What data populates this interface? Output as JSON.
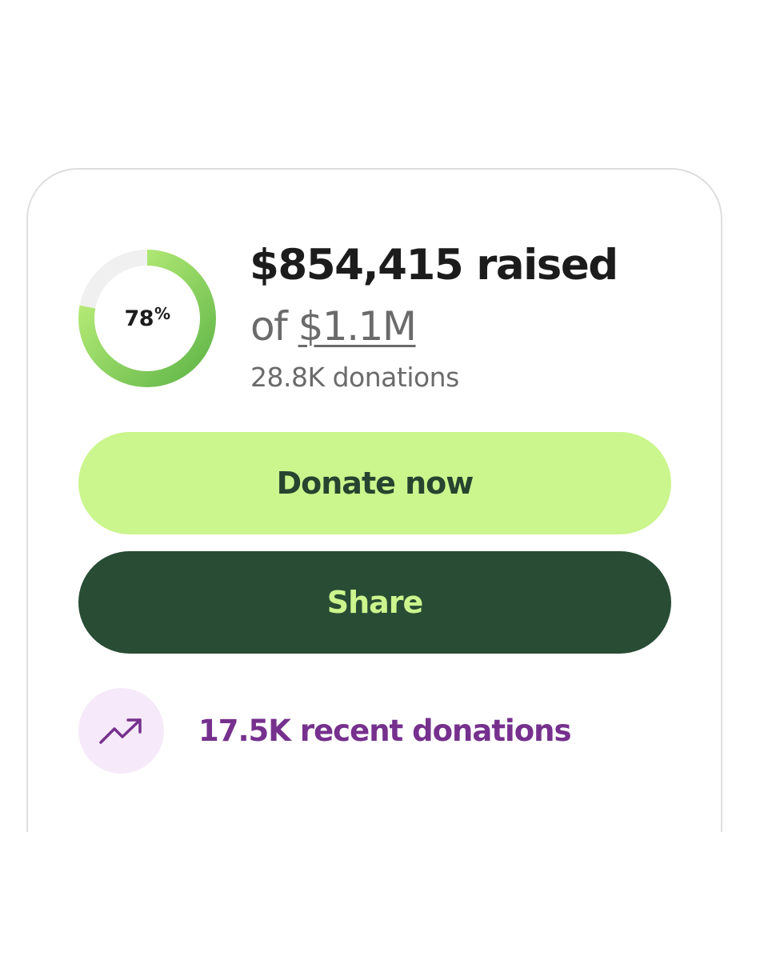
{
  "progress": {
    "percent_label": "78",
    "percent_symbol": "%",
    "fraction": 0.78
  },
  "summary": {
    "raised_text": "$854,415 raised",
    "goal_prefix": "of ",
    "goal_amount": "$1.1M",
    "donation_count": "28.8K donations"
  },
  "actions": {
    "donate_label": "Donate now",
    "share_label": "Share"
  },
  "recent": {
    "label": "17.5K recent donations",
    "icon": "trending-up-icon"
  },
  "colors": {
    "ring_track": "#f0f0f0",
    "ring_start": "#5fb548",
    "ring_end": "#c6f57f",
    "donate_bg": "#cbf58d",
    "share_bg": "#284c34",
    "recent_text": "#76308d"
  }
}
